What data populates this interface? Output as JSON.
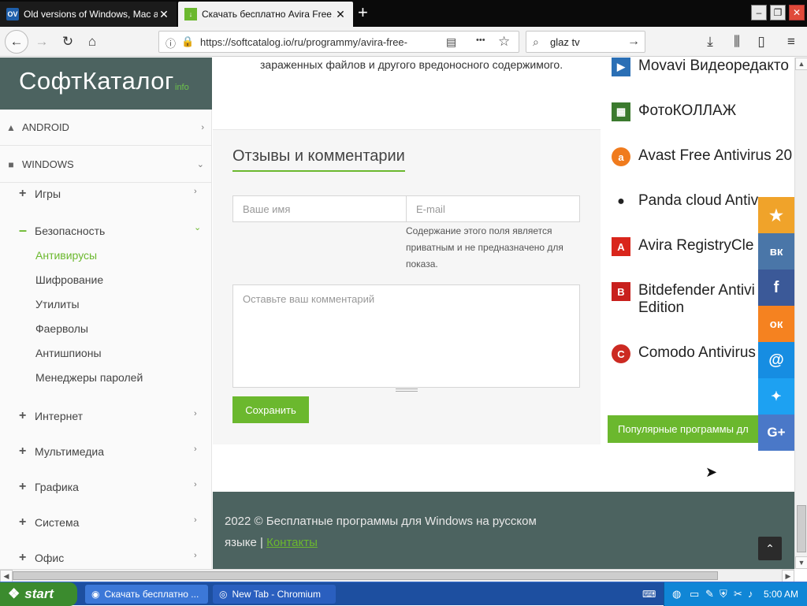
{
  "tabs": [
    {
      "favicon": "OV",
      "title": "Old versions of Windows, Mac and",
      "close": "✕"
    },
    {
      "favicon": "↓",
      "title": "Скачать бесплатно Avira Free A",
      "close": "✕"
    }
  ],
  "new_tab_glyph": "+",
  "window_buttons": {
    "minimize": "–",
    "restore": "❐",
    "close": "✕"
  },
  "toolbar": {
    "back": "←",
    "forward": "→",
    "reload": "↻",
    "home": "⌂",
    "url": "https://softcatalog.io/ru/programmy/avira-free-",
    "reader": "▤",
    "more": "•••",
    "bookmark": "☆",
    "search_value": "glaz tv",
    "search_go": "→",
    "download": "⤓",
    "library": "⫼",
    "sidebar": "▯",
    "menu": "≡"
  },
  "logo": {
    "name": "СофтКаталог",
    "suffix": "info"
  },
  "sidebar": {
    "categories": [
      {
        "label": "ANDROID",
        "icon": "android-icon",
        "chevron": "›"
      },
      {
        "label": "WINDOWS",
        "icon": "windows-icon",
        "chevron": "⌄"
      }
    ],
    "groups": [
      {
        "label": "Игры",
        "sign": "+",
        "chevron": "›"
      },
      {
        "label": "Безопасность",
        "sign": "–",
        "chevron": "⌄"
      }
    ],
    "security_items": [
      "Антивирусы",
      "Шифрование",
      "Утилиты",
      "Фаерволы",
      "Антишпионы",
      "Менеджеры паролей"
    ],
    "more_groups": [
      {
        "label": "Интернет",
        "sign": "+",
        "chevron": "›"
      },
      {
        "label": "Мультимедиа",
        "sign": "+",
        "chevron": "›"
      },
      {
        "label": "Графика",
        "sign": "+",
        "chevron": "›"
      },
      {
        "label": "Система",
        "sign": "+",
        "chevron": "›"
      },
      {
        "label": "Офис",
        "sign": "+",
        "chevron": "›"
      }
    ]
  },
  "main": {
    "top_description": "зараженных файлов и другого вредоносного содержимого.",
    "comments": {
      "title": "Отзывы и комментарии",
      "name_placeholder": "Ваше имя",
      "email_placeholder": "E-mail",
      "privacy_note": "Содержание этого поля является приватным и не предназначено для показа.",
      "comment_placeholder": "Оставьте ваш комментарий",
      "save_label": "Сохранить"
    }
  },
  "right_list": [
    {
      "name": "Movavi Видеоредакто",
      "icon": "movavi-icon",
      "color": "#2a6fb5"
    },
    {
      "name": "ФотоКОЛЛАЖ",
      "icon": "fotokollazh-icon",
      "color": "#3b7a2e"
    },
    {
      "name": "Avast Free Antivirus 20",
      "icon": "avast-icon",
      "color": "#f07b1d"
    },
    {
      "name": "Panda cloud Antiv",
      "icon": "panda-icon",
      "color": "#222222"
    },
    {
      "name": "Avira RegistryCle",
      "icon": "avira-icon",
      "color": "#d9261c"
    },
    {
      "name": "Bitdefender Antivi Edition",
      "icon": "bitdefender-icon",
      "color": "#c8201d"
    },
    {
      "name": "Comodo Antivirus",
      "icon": "comodo-icon",
      "color": "#cc2a22"
    }
  ],
  "popular_button": "Популярные программы дл",
  "social": [
    {
      "icon": "star-icon",
      "glyph": "★",
      "color": "#f0a32a"
    },
    {
      "icon": "vk-icon",
      "glyph": "вк",
      "color": "#4a76a8"
    },
    {
      "icon": "facebook-icon",
      "glyph": "f",
      "color": "#3b5998"
    },
    {
      "icon": "odnoklassniki-icon",
      "glyph": "ок",
      "color": "#f58220"
    },
    {
      "icon": "mail-ru-icon",
      "glyph": "@",
      "color": "#168de2"
    },
    {
      "icon": "twitter-icon",
      "glyph": "🐦",
      "color": "#1da1f2"
    },
    {
      "icon": "google-plus-icon",
      "glyph": "G+",
      "color": "#4a78c8"
    }
  ],
  "footer": {
    "text": "2022 © Бесплатные программы для Windows на русском языке | ",
    "link": "Контакты",
    "to_top": "⌃"
  },
  "taskbar": {
    "start": "start",
    "tasks": [
      "Скачать бесплатно ...",
      "New Tab - Chromium"
    ],
    "clock": "5:00 AM"
  },
  "colors": {
    "accent": "#6bb82e",
    "dark": "#4c6360"
  }
}
